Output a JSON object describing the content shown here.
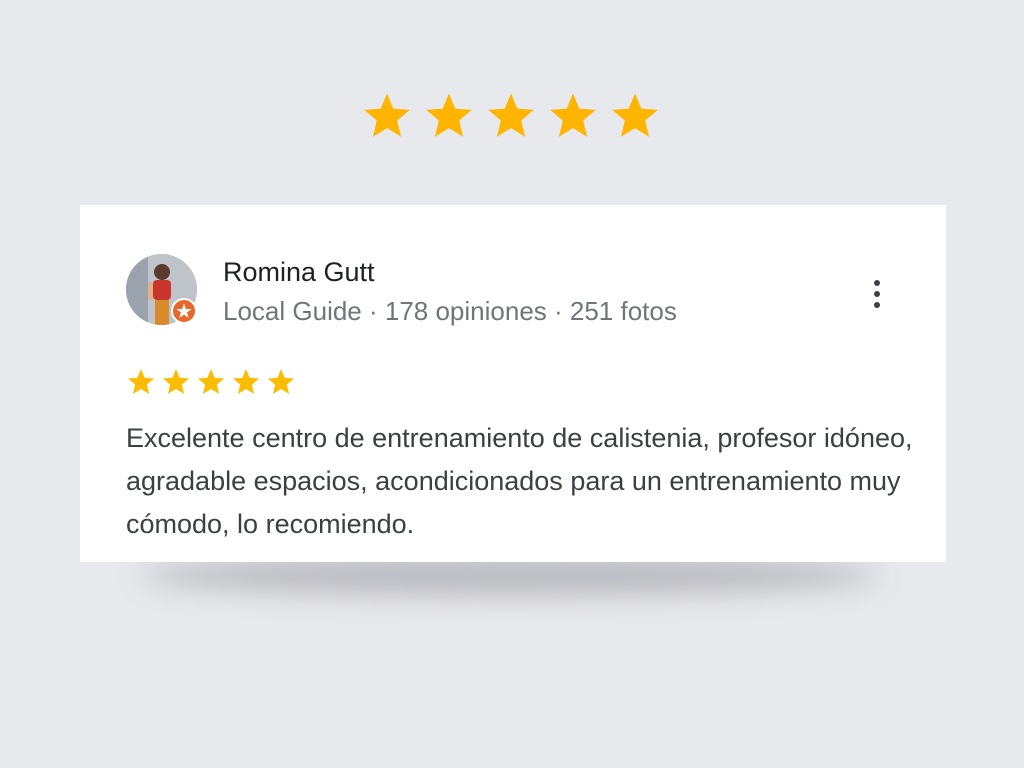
{
  "header_rating": {
    "stars": 5,
    "max": 5,
    "icon": "star-icon",
    "color": "#ffb400"
  },
  "review": {
    "reviewer_name": "Romina Gutt",
    "reviewer_meta": "Local Guide · 178 opiniones · 251 fotos",
    "badge_icon": "local-guide-badge-icon",
    "badge_color": "#e8672a",
    "more_icon": "more-vert-icon",
    "rating": 5,
    "rating_max": 5,
    "star_color": "#fbbc04",
    "text": "Excelente centro de entrenamiento de calistenia, profesor idóneo, agradable espacios, acondicionados para un entrenamiento muy cómodo, lo recomiendo."
  },
  "colors": {
    "background": "#e8e9ed",
    "card": "#ffffff",
    "name_text": "#202124",
    "meta_text": "#70757a",
    "body_text": "#3c4043"
  }
}
